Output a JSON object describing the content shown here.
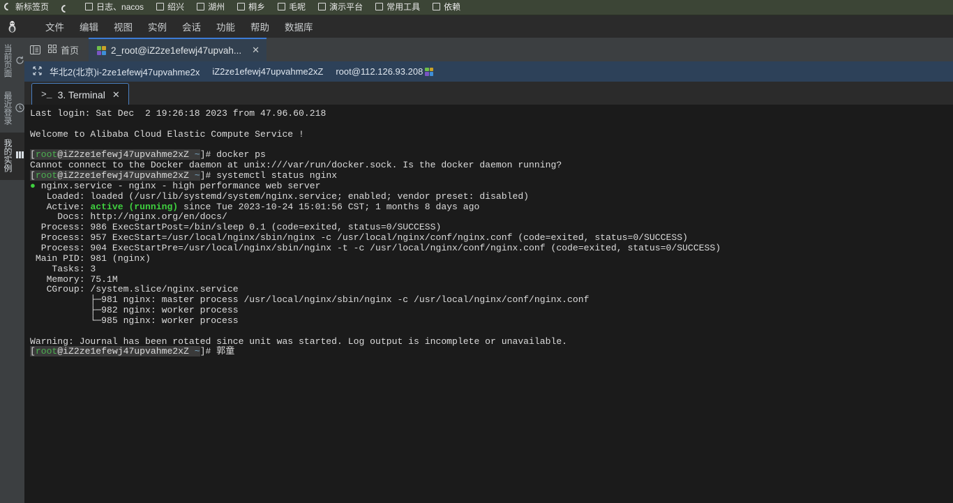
{
  "bookmark_bar": {
    "items": [
      {
        "label": "新标签页",
        "icon": "globe-icon"
      },
      {
        "label": "",
        "icon": "globe-icon"
      },
      {
        "label": "日志、nacos",
        "icon": "folder-icon"
      },
      {
        "label": "绍兴",
        "icon": "folder-icon"
      },
      {
        "label": "湖州",
        "icon": "folder-icon"
      },
      {
        "label": "桐乡",
        "icon": "folder-icon"
      },
      {
        "label": "毛呢",
        "icon": "folder-icon"
      },
      {
        "label": "演示平台",
        "icon": "folder-icon"
      },
      {
        "label": "常用工具",
        "icon": "folder-icon"
      },
      {
        "label": "依赖",
        "icon": "folder-icon"
      }
    ]
  },
  "menubar": {
    "logo": "penguin-logo",
    "items": [
      "文件",
      "编辑",
      "视图",
      "实例",
      "会话",
      "功能",
      "帮助",
      "数据库"
    ]
  },
  "rail": {
    "items": [
      {
        "label": "当前页面",
        "icon": "refresh-icon",
        "active": false
      },
      {
        "label": "最近登录",
        "icon": "clock-icon",
        "active": false
      },
      {
        "label": "我的实例",
        "icon": "servers-icon",
        "active": true
      }
    ]
  },
  "tabstrip": {
    "toggle_icon": "panel-toggle-icon",
    "home_label": "首页",
    "home_icon": "grid-icon",
    "tabs": [
      {
        "label": "2_root@iZ2ze1efewj47upvah...",
        "icon": "session-icon",
        "close": "✕",
        "active": true
      }
    ]
  },
  "breadcrumb": {
    "expand_icon": "expand-icon",
    "crumbs": [
      "华北2(北京)i-2ze1efewj47upvahme2x",
      "iZ2ze1efewj47upvahme2xZ",
      "root@112.126.93.208"
    ],
    "trailing_icon": "session-icon"
  },
  "terminal_tab": {
    "icon": "prompt-icon",
    "label": "3. Terminal",
    "close": "✕"
  },
  "console": {
    "lines": [
      {
        "type": "plain",
        "text": "Last login: Sat Dec  2 19:26:18 2023 from 47.96.60.218"
      },
      {
        "type": "plain",
        "text": ""
      },
      {
        "type": "plain",
        "text": "Welcome to Alibaba Cloud Elastic Compute Service !"
      },
      {
        "type": "plain",
        "text": ""
      },
      {
        "type": "prompt",
        "user": "root",
        "host": "@iZ2ze1efewj47upvahme2xZ",
        "cwd": "~",
        "suffix": "]# ",
        "command": "docker ps"
      },
      {
        "type": "plain",
        "text": "Cannot connect to the Docker daemon at unix:///var/run/docker.sock. Is the docker daemon running?"
      },
      {
        "type": "prompt",
        "user": "root",
        "host": "@iZ2ze1efewj47upvahme2xZ",
        "cwd": "~",
        "suffix": "]# ",
        "command": "systemctl status nginx"
      },
      {
        "type": "status",
        "text": "nginx.service - nginx - high performance web server"
      },
      {
        "type": "plain",
        "text": "   Loaded: loaded (/usr/lib/systemd/system/nginx.service; enabled; vendor preset: disabled)"
      },
      {
        "type": "active",
        "prefix": "   Active: ",
        "state": "active (running)",
        "rest": " since Tue 2023-10-24 15:01:56 CST; 1 months 8 days ago"
      },
      {
        "type": "plain",
        "text": "     Docs: http://nginx.org/en/docs/"
      },
      {
        "type": "plain",
        "text": "  Process: 986 ExecStartPost=/bin/sleep 0.1 (code=exited, status=0/SUCCESS)"
      },
      {
        "type": "plain",
        "text": "  Process: 957 ExecStart=/usr/local/nginx/sbin/nginx -c /usr/local/nginx/conf/nginx.conf (code=exited, status=0/SUCCESS)"
      },
      {
        "type": "plain",
        "text": "  Process: 904 ExecStartPre=/usr/local/nginx/sbin/nginx -t -c /usr/local/nginx/conf/nginx.conf (code=exited, status=0/SUCCESS)"
      },
      {
        "type": "plain",
        "text": " Main PID: 981 (nginx)"
      },
      {
        "type": "plain",
        "text": "    Tasks: 3"
      },
      {
        "type": "plain",
        "text": "   Memory: 75.1M"
      },
      {
        "type": "plain",
        "text": "   CGroup: /system.slice/nginx.service"
      },
      {
        "type": "plain",
        "text": "           ├─981 nginx: master process /usr/local/nginx/sbin/nginx -c /usr/local/nginx/conf/nginx.conf"
      },
      {
        "type": "plain",
        "text": "           ├─982 nginx: worker process"
      },
      {
        "type": "plain",
        "text": "           └─985 nginx: worker process"
      },
      {
        "type": "plain",
        "text": ""
      },
      {
        "type": "plain",
        "text": "Warning: Journal has been rotated since unit was started. Log output is incomplete or unavailable."
      },
      {
        "type": "prompt",
        "user": "root",
        "host": "@iZ2ze1efewj47upvahme2xZ",
        "cwd": "~",
        "suffix": "]# ",
        "command": "郭童"
      }
    ]
  },
  "colors": {
    "bookmark_bar_bg": "#3c4536",
    "chrome_bg": "#2b2b2b",
    "rail_bg": "#3c3f41",
    "tab_active_bg": "#32404f",
    "tab_accent": "#3c7cd6",
    "breadcrumb_bg": "#2d4159",
    "console_bg": "#1b1b1b",
    "console_fg": "#dcdcdc",
    "prompt_green": "#4caf50",
    "active_green": "#3fd13f"
  }
}
